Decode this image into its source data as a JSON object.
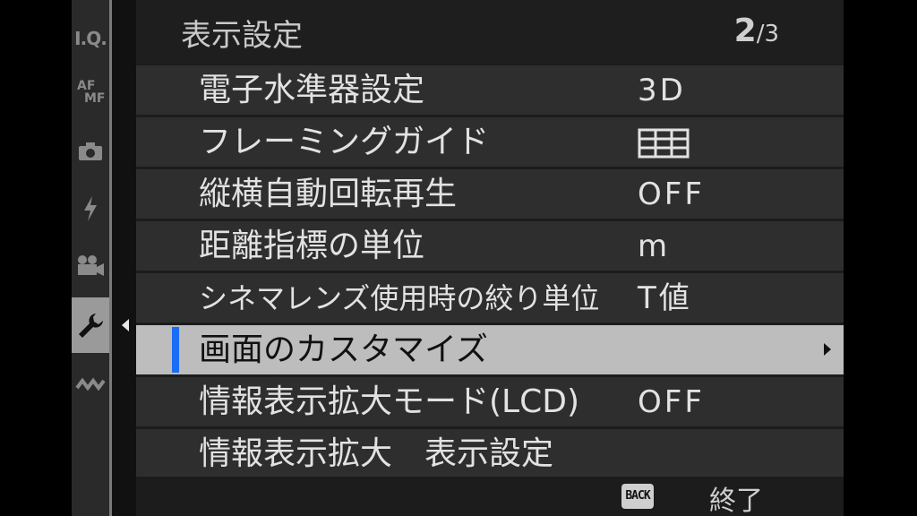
{
  "header": {
    "title": "表示設定",
    "page_current": "2",
    "page_separator": "/",
    "page_total": "3"
  },
  "side_tabs": [
    {
      "name": "I.Q.",
      "icon": "image-quality-icon",
      "active": false
    },
    {
      "name": "AF MF",
      "icon": "af-mf-icon",
      "active": false
    },
    {
      "name": "camera",
      "icon": "camera-icon",
      "active": false
    },
    {
      "name": "flash",
      "icon": "flash-icon",
      "active": false
    },
    {
      "name": "movie",
      "icon": "movie-camera-icon",
      "active": false
    },
    {
      "name": "setup",
      "icon": "wrench-icon",
      "active": true
    },
    {
      "name": "connection",
      "icon": "wireless-icon",
      "active": false
    }
  ],
  "side_tab_text": {
    "iq": "I.Q.",
    "af": "AF",
    "mf": "MF"
  },
  "menu_items": [
    {
      "label": "電子水準器設定",
      "value": "3D"
    },
    {
      "label": "フレーミングガイド",
      "value_icon": "grid-9-icon"
    },
    {
      "label": "縦横自動回転再生",
      "value": "OFF"
    },
    {
      "label": "距離指標の単位",
      "value": "m"
    },
    {
      "label": "シネマレンズ使用時の絞り単位",
      "value": "T値"
    },
    {
      "label": "画面のカスタマイズ",
      "selected": true,
      "submenu": true
    },
    {
      "label": "情報表示拡大モード(LCD)",
      "value": "OFF"
    },
    {
      "label": "情報表示拡大　表示設定"
    }
  ],
  "footer": {
    "back_badge": "BACK",
    "back_label": "終了"
  },
  "colors": {
    "selection_marker": "#1a6cf5",
    "selected_row": "#bdbdbd",
    "row_bg": "#2e2e2e",
    "text": "#e2e2e2"
  }
}
